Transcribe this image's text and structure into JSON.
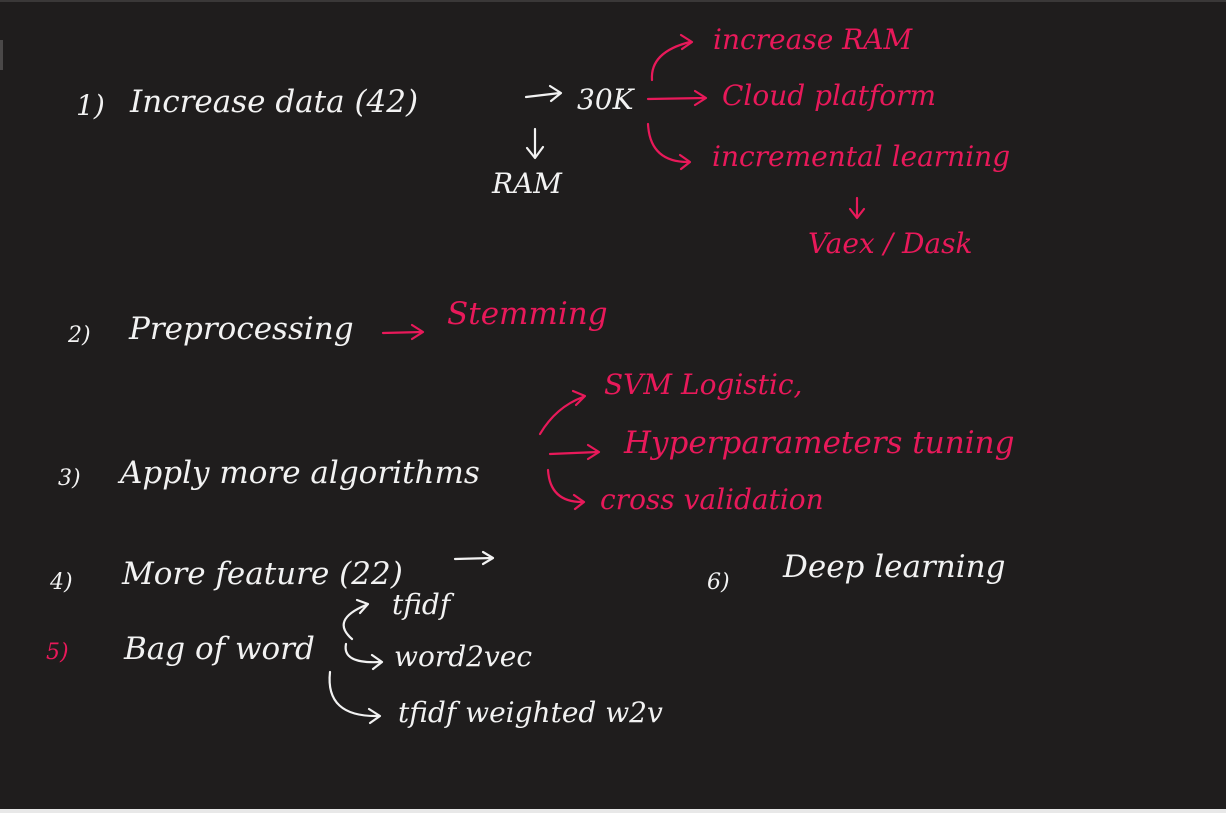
{
  "colors": {
    "background": "#1f1d1d",
    "white_ink": "#f2f2f2",
    "pink_ink": "#e8195a"
  },
  "notes": {
    "item1": {
      "number": "1)",
      "text": "Increase data (42)",
      "target": "30K",
      "sub": "RAM",
      "options": [
        "increase RAM",
        "Cloud platform",
        "incremental learning"
      ],
      "tool": "Vaex / Dask"
    },
    "item2": {
      "number": "2)",
      "text": "Preprocessing",
      "target": "Stemming"
    },
    "item3": {
      "number": "3)",
      "text": "Apply more algorithms",
      "options": [
        "SVM Logistic,",
        "Hyperparameters tuning",
        "cross validation"
      ]
    },
    "item4": {
      "number": "4)",
      "text": "More feature (22)"
    },
    "item5": {
      "number": "5)",
      "text": "Bag of word",
      "options": [
        "tfidf",
        "word2vec",
        "tfidf weighted w2v"
      ]
    },
    "item6": {
      "number": "6)",
      "text": "Deep learning"
    }
  }
}
